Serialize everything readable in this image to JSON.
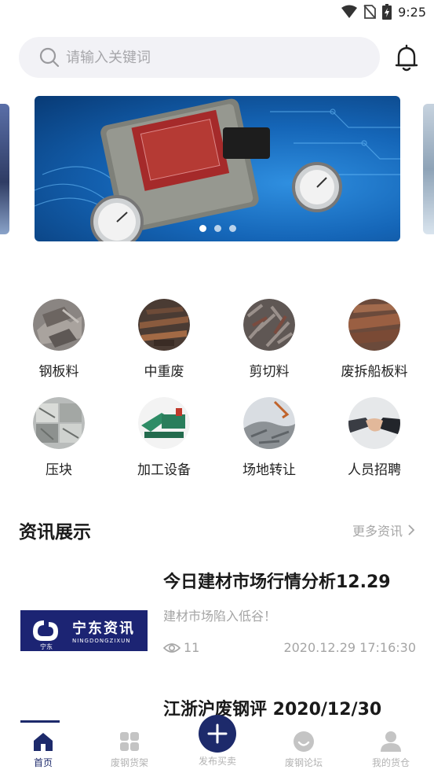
{
  "status_bar": {
    "time": "9:25"
  },
  "search": {
    "placeholder": "请输入关键词"
  },
  "banner": {
    "page_count": 3,
    "active_index": 0
  },
  "categories": [
    {
      "label": "钢板料"
    },
    {
      "label": "中重废"
    },
    {
      "label": "剪切料"
    },
    {
      "label": "废拆船板料"
    },
    {
      "label": "压块"
    },
    {
      "label": "加工设备"
    },
    {
      "label": "场地转让"
    },
    {
      "label": "人员招聘"
    }
  ],
  "news": {
    "section_title": "资讯展示",
    "more_label": "更多资讯",
    "items": [
      {
        "headline": "今日建材市场行情分析12.29",
        "summary": "建材市场陷入低谷！",
        "views": "11",
        "time": "2020.12.29 17:16:30",
        "thumb_title": "宁东资讯",
        "thumb_sub": "NINGDONGZIXUN",
        "thumb_logo_text": "宁东"
      },
      {
        "headline": "江浙沪废钢评 2020/12/30"
      }
    ]
  },
  "bottom_nav": {
    "items": [
      {
        "label": "首页"
      },
      {
        "label": "废钢货架"
      },
      {
        "label": "发布买卖"
      },
      {
        "label": "废钢论坛"
      },
      {
        "label": "我的货仓"
      }
    ]
  },
  "colors": {
    "brand": "#1d2a6b",
    "muted": "#a5a5a5"
  }
}
